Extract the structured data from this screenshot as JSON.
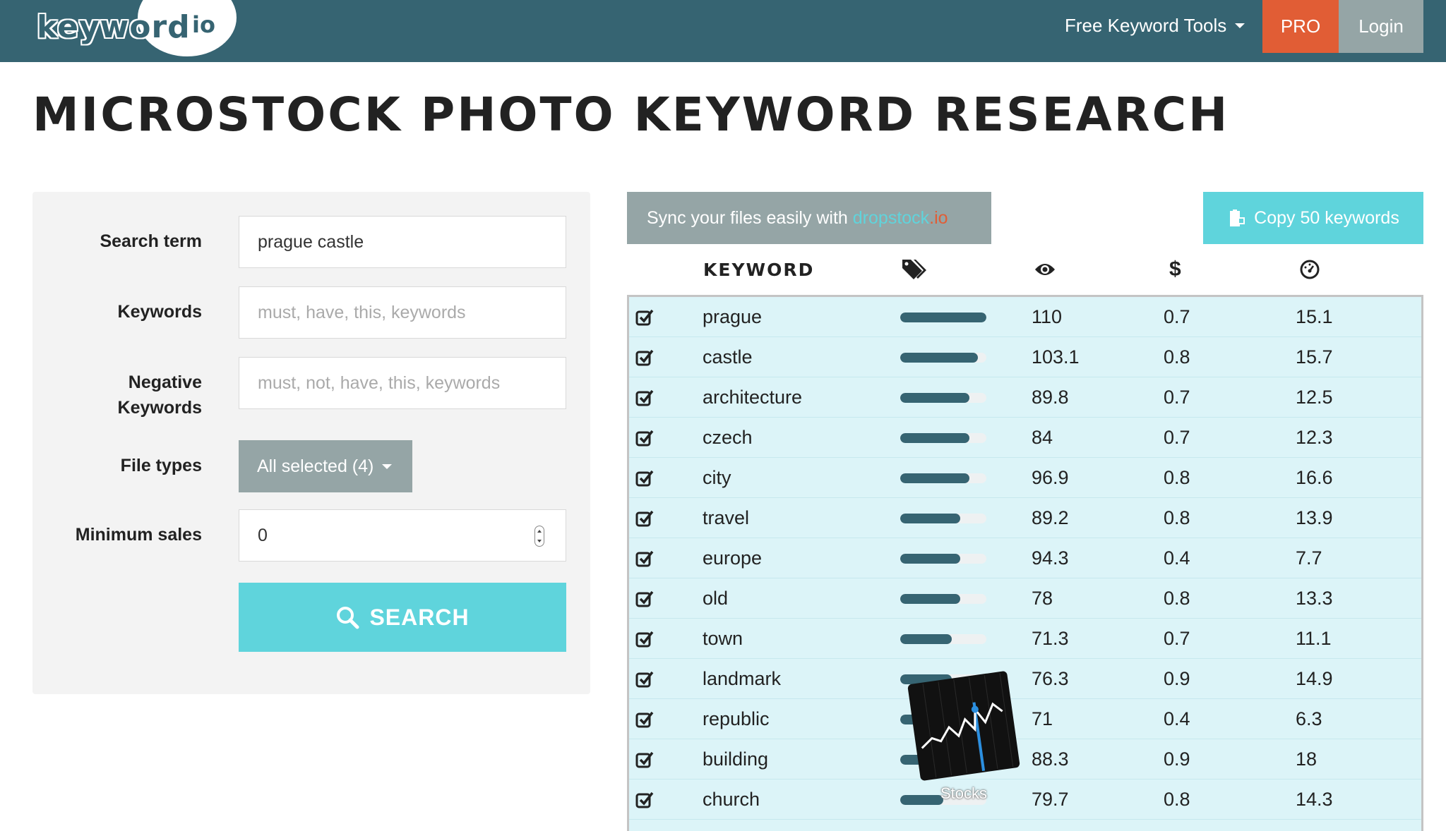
{
  "nav": {
    "logo_word": "keyword",
    "logo_io": "io",
    "tools_label": "Free Keyword Tools",
    "pro_label": "PRO",
    "login_label": "Login"
  },
  "page_title": "MICROSTOCK PHOTO KEYWORD RESEARCH",
  "form": {
    "search_term_label": "Search term",
    "search_term_value": "prague castle",
    "keywords_label": "Keywords",
    "keywords_placeholder": "must, have, this, keywords",
    "negative_label_1": "Negative",
    "negative_label_2": "Keywords",
    "negative_placeholder": "must, not, have, this, keywords",
    "file_types_label": "File types",
    "file_types_value": "All selected (4)",
    "min_sales_label": "Minimum sales",
    "min_sales_value": "0",
    "search_button": "SEARCH"
  },
  "sync": {
    "text": "Sync your files easily with ",
    "brand": "dropstock",
    "brand_tld": ".io"
  },
  "copy_button": "Copy 50 keywords",
  "table": {
    "keyword_header": "KEYWORD",
    "header_icons": [
      "tags-icon",
      "eye-icon",
      "dollar-icon",
      "gauge-icon"
    ],
    "price_header": "$",
    "rows": [
      {
        "keyword": "prague",
        "bar": 1.0,
        "views": "110",
        "price": "0.7",
        "comp": "15.1"
      },
      {
        "keyword": "castle",
        "bar": 0.9,
        "views": "103.1",
        "price": "0.8",
        "comp": "15.7"
      },
      {
        "keyword": "architecture",
        "bar": 0.8,
        "views": "89.8",
        "price": "0.7",
        "comp": "12.5"
      },
      {
        "keyword": "czech",
        "bar": 0.8,
        "views": "84",
        "price": "0.7",
        "comp": "12.3"
      },
      {
        "keyword": "city",
        "bar": 0.8,
        "views": "96.9",
        "price": "0.8",
        "comp": "16.6"
      },
      {
        "keyword": "travel",
        "bar": 0.7,
        "views": "89.2",
        "price": "0.8",
        "comp": "13.9"
      },
      {
        "keyword": "europe",
        "bar": 0.7,
        "views": "94.3",
        "price": "0.4",
        "comp": "7.7"
      },
      {
        "keyword": "old",
        "bar": 0.7,
        "views": "78",
        "price": "0.8",
        "comp": "13.3"
      },
      {
        "keyword": "town",
        "bar": 0.6,
        "views": "71.3",
        "price": "0.7",
        "comp": "11.1"
      },
      {
        "keyword": "landmark",
        "bar": 0.6,
        "views": "76.3",
        "price": "0.9",
        "comp": "14.9"
      },
      {
        "keyword": "republic",
        "bar": 0.5,
        "views": "71",
        "price": "0.4",
        "comp": "6.3"
      },
      {
        "keyword": "building",
        "bar": 0.5,
        "views": "88.3",
        "price": "0.9",
        "comp": "18"
      },
      {
        "keyword": "church",
        "bar": 0.5,
        "views": "79.7",
        "price": "0.8",
        "comp": "14.3"
      }
    ]
  },
  "overlay": {
    "stocks_label": "Stocks"
  },
  "colors": {
    "nav_bg": "#366472",
    "accent_cyan": "#5fd4dc",
    "accent_orange": "#e15d35",
    "gray_btn": "#95a5a6",
    "table_bg": "#dcf4f8"
  }
}
